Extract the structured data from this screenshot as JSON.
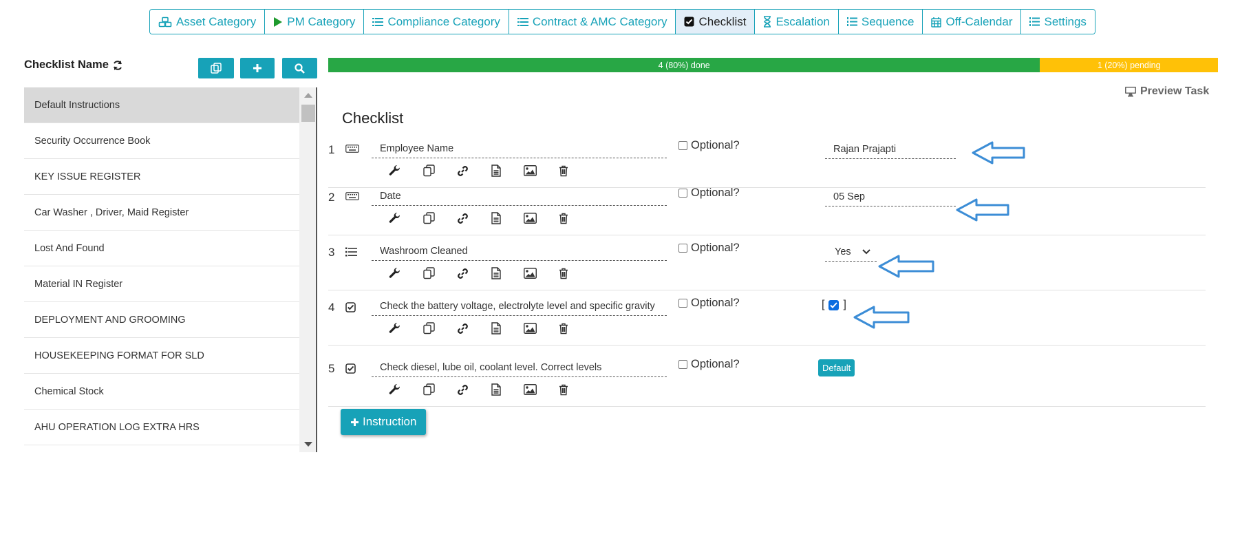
{
  "tabs": [
    {
      "label": "Asset Category",
      "icon": "cubes-icon",
      "active": false
    },
    {
      "label": "PM Category",
      "icon": "play-icon",
      "active": false
    },
    {
      "label": "Compliance Category",
      "icon": "list-icon",
      "active": false
    },
    {
      "label": "Contract & AMC Category",
      "icon": "list-icon",
      "active": false
    },
    {
      "label": "Checklist",
      "icon": "checkbox-icon",
      "active": true
    },
    {
      "label": "Escalation",
      "icon": "hourglass-icon",
      "active": false
    },
    {
      "label": "Sequence",
      "icon": "ordered-list-icon",
      "active": false
    },
    {
      "label": "Off-Calendar",
      "icon": "calendar-icon",
      "active": false
    },
    {
      "label": "Settings",
      "icon": "ordered-list-icon",
      "active": false
    }
  ],
  "sidebar": {
    "title": "Checklist Name",
    "items": [
      "Default Instructions",
      "Security Occurrence Book",
      "KEY ISSUE REGISTER",
      "Car Washer , Driver, Maid Register",
      "Lost And Found",
      "Material IN Register",
      "DEPLOYMENT AND GROOMING",
      "HOUSEKEEPING FORMAT FOR SLD",
      "Chemical Stock",
      "AHU OPERATION LOG EXTRA HRS"
    ],
    "selected_index": 0
  },
  "progress": {
    "done_label": "4 (80%) done",
    "done_fraction": 0.8,
    "pending_label": "1 (20%) pending",
    "done_color": "#28a745",
    "pending_color": "#ffc107"
  },
  "preview_label": "Preview Task",
  "section_title": "Checklist",
  "optional_label": "Optional?",
  "rows": [
    {
      "num": "1",
      "type_icon": "keyboard-icon",
      "title": "Employee Name",
      "value_type": "text",
      "value": "Rajan Prajapti"
    },
    {
      "num": "2",
      "type_icon": "keyboard-icon",
      "title": "Date",
      "value_type": "text",
      "value": "05 Sep"
    },
    {
      "num": "3",
      "type_icon": "list-icon",
      "title": "Washroom Cleaned",
      "value_type": "select",
      "value": "Yes"
    },
    {
      "num": "4",
      "type_icon": "checkbox-icon",
      "title": "Check the battery voltage, electrolyte level and specific gravity",
      "value_type": "bool",
      "checked": true,
      "value_open": "[",
      "value_close": "]"
    },
    {
      "num": "5",
      "type_icon": "checkbox-icon",
      "title": "Check diesel, lube oil, coolant level. Correct levels",
      "value_type": "default",
      "value": "Default"
    }
  ],
  "add_button_label": "Instruction",
  "colors": {
    "accent": "#17a2b8",
    "annotation_arrow": "#3c8dd6"
  }
}
